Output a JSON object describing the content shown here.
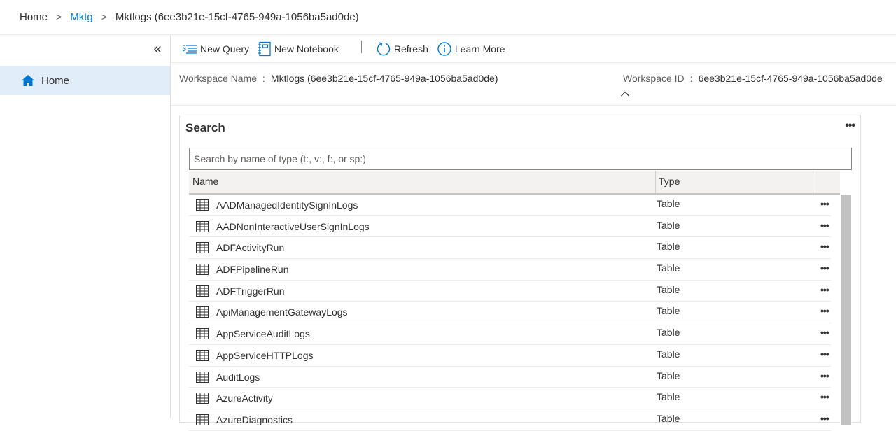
{
  "breadcrumb": {
    "home": "Home",
    "mktg": "Mktg",
    "current": "Mktlogs (6ee3b21e-15cf-4765-949a-1056ba5ad0de)",
    "separator": ">"
  },
  "sidebar": {
    "collapse_glyph": "«",
    "home_label": "Home"
  },
  "toolbar": {
    "new_query": "New Query",
    "new_notebook": "New Notebook",
    "refresh": "Refresh",
    "learn_more": "Learn More"
  },
  "workspace": {
    "name_label": "Workspace Name",
    "name_value": "Mktlogs (6ee3b21e-15cf-4765-949a-1056ba5ad0de)",
    "id_label": "Workspace ID",
    "id_value": "6ee3b21e-15cf-4765-949a-1056ba5ad0de",
    "colon": ":"
  },
  "search": {
    "title": "Search",
    "more": "•••",
    "placeholder": "Search by name of type (t:, v:, f:, or sp:)",
    "columns": {
      "name": "Name",
      "type": "Type"
    },
    "rows": [
      {
        "name": "AADManagedIdentitySignInLogs",
        "type": "Table",
        "more": "•••"
      },
      {
        "name": "AADNonInteractiveUserSignInLogs",
        "type": "Table",
        "more": "•••"
      },
      {
        "name": "ADFActivityRun",
        "type": "Table",
        "more": "•••"
      },
      {
        "name": "ADFPipelineRun",
        "type": "Table",
        "more": "•••"
      },
      {
        "name": "ADFTriggerRun",
        "type": "Table",
        "more": "•••"
      },
      {
        "name": "ApiManagementGatewayLogs",
        "type": "Table",
        "more": "•••"
      },
      {
        "name": "AppServiceAuditLogs",
        "type": "Table",
        "more": "•••"
      },
      {
        "name": "AppServiceHTTPLogs",
        "type": "Table",
        "more": "•••"
      },
      {
        "name": "AuditLogs",
        "type": "Table",
        "more": "•••"
      },
      {
        "name": "AzureActivity",
        "type": "Table",
        "more": "•••"
      },
      {
        "name": "AzureDiagnostics",
        "type": "Table",
        "more": "•••"
      }
    ]
  },
  "colors": {
    "accent": "#0078d4",
    "selected_nav": "#e1eefa",
    "scroll_thumb": "#c2c2c2"
  }
}
